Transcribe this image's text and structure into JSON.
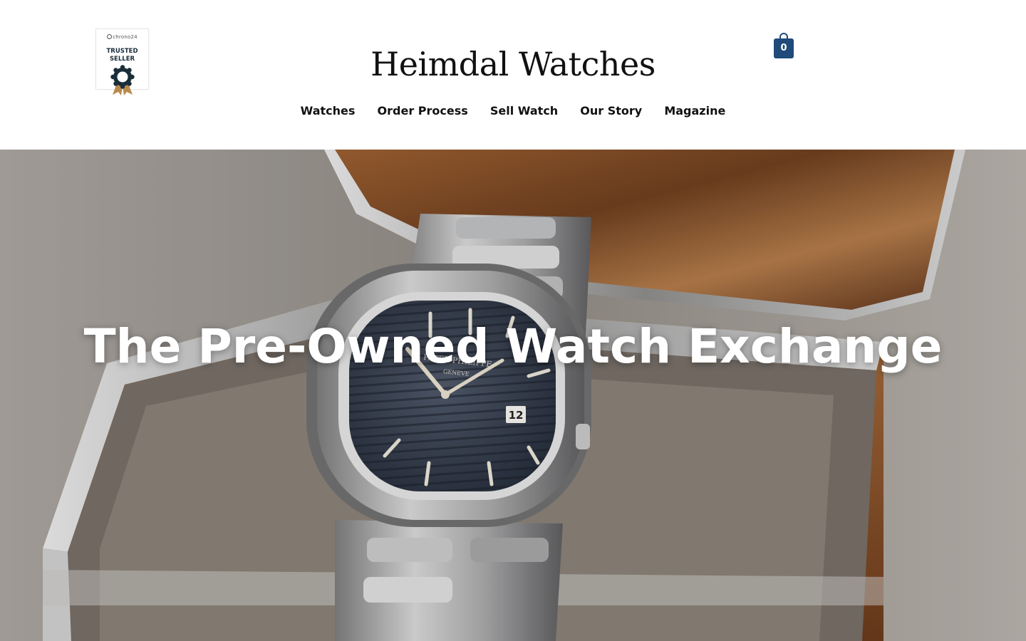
{
  "badge": {
    "brand": "chrono24",
    "line1": "TRUSTED",
    "line2": "SELLER",
    "seal_color": "#1a2e3a",
    "ribbon_color": "#b98a4e"
  },
  "site": {
    "title": "Heimdal Watches"
  },
  "cart": {
    "icon": "shopping-bag-icon",
    "count": "0",
    "color": "#1f4a7a"
  },
  "nav": {
    "items": [
      {
        "label": "Watches"
      },
      {
        "label": "Order Process"
      },
      {
        "label": "Sell Watch"
      },
      {
        "label": "Our Story"
      },
      {
        "label": "Magazine"
      }
    ]
  },
  "hero": {
    "headline": "The Pre-Owned Watch Exchange",
    "dial_text_1": "PATEK PHILIPPE",
    "dial_text_2": "GENEVE",
    "date_window": "12"
  }
}
